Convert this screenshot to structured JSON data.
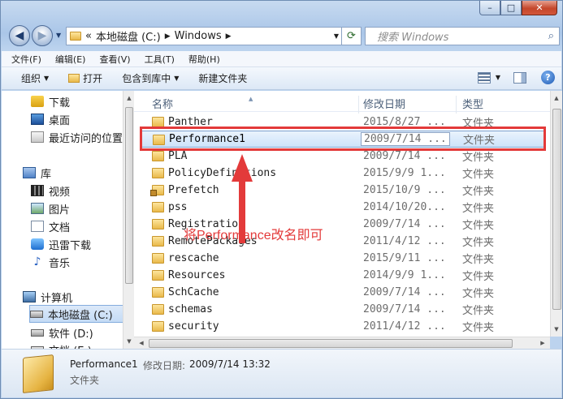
{
  "window": {
    "caption": {
      "minimize": "–",
      "maximize": "□",
      "close": "✕"
    }
  },
  "address": {
    "overflow": "«",
    "crumbs": [
      "本地磁盘 (C:)",
      "Windows"
    ],
    "search_placeholder": "搜索 Windows"
  },
  "menu": [
    "文件(F)",
    "编辑(E)",
    "查看(V)",
    "工具(T)",
    "帮助(H)"
  ],
  "toolbar": {
    "organize": "组织",
    "open": "打开",
    "include_in_library": "包含到库中",
    "new_folder": "新建文件夹"
  },
  "nav_pane": {
    "favorites": [
      "下载",
      "桌面",
      "最近访问的位置"
    ],
    "libraries_header": "库",
    "libraries": [
      "视频",
      "图片",
      "文档",
      "迅雷下载",
      "音乐"
    ],
    "computer_header": "计算机",
    "drives": [
      "本地磁盘 (C:)",
      "软件 (D:)",
      "文档 (E:)"
    ]
  },
  "columns": {
    "name": "名称",
    "date": "修改日期",
    "type": "类型"
  },
  "files": [
    {
      "name": "Panther",
      "date": "2015/8/27 ...",
      "type": "文件夹"
    },
    {
      "name": "Performance1",
      "date": "2009/7/14 ...",
      "type": "文件夹",
      "selected": true
    },
    {
      "name": "PLA",
      "date": "2009/7/14 ...",
      "type": "文件夹"
    },
    {
      "name": "PolicyDefinitions",
      "date": "2015/9/9 1...",
      "type": "文件夹"
    },
    {
      "name": "Prefetch",
      "date": "2015/10/9 ...",
      "type": "文件夹",
      "locked": true
    },
    {
      "name": "pss",
      "date": "2014/10/20...",
      "type": "文件夹"
    },
    {
      "name": "Registration",
      "date": "2009/7/14 ...",
      "type": "文件夹"
    },
    {
      "name": "RemotePackages",
      "date": "2011/4/12 ...",
      "type": "文件夹"
    },
    {
      "name": "rescache",
      "date": "2015/9/11 ...",
      "type": "文件夹"
    },
    {
      "name": "Resources",
      "date": "2014/9/9 1...",
      "type": "文件夹"
    },
    {
      "name": "SchCache",
      "date": "2009/7/14 ...",
      "type": "文件夹"
    },
    {
      "name": "schemas",
      "date": "2009/7/14 ...",
      "type": "文件夹"
    },
    {
      "name": "security",
      "date": "2011/4/12 ...",
      "type": "文件夹"
    }
  ],
  "details": {
    "name": "Performance1",
    "date_label": "修改日期:",
    "date": "2009/7/14 13:32",
    "type": "文件夹"
  },
  "annotation": {
    "text": "将Performance改名即可",
    "color": "#e33a3a"
  }
}
